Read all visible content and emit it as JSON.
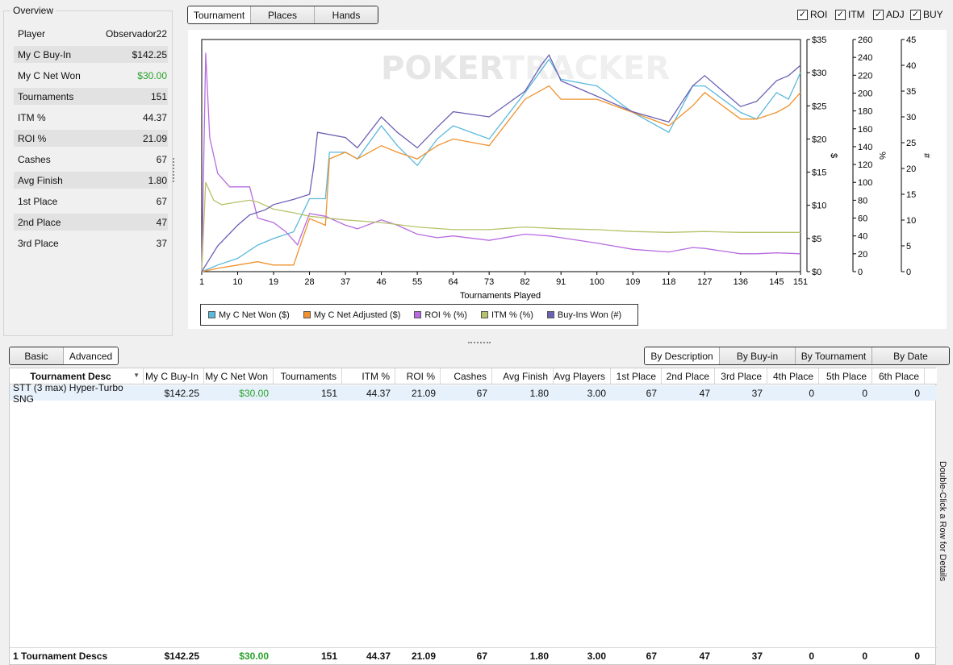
{
  "overview": {
    "title": "Overview",
    "rows": [
      {
        "label": "Player",
        "value": "Observador22"
      },
      {
        "label": "My C Buy-In",
        "value": "$142.25"
      },
      {
        "label": "My C Net Won",
        "value": "$30.00"
      },
      {
        "label": "Tournaments",
        "value": "151"
      },
      {
        "label": "ITM %",
        "value": "44.37"
      },
      {
        "label": "ROI %",
        "value": "21.09"
      },
      {
        "label": "Cashes",
        "value": "67"
      },
      {
        "label": "Avg Finish",
        "value": "1.80"
      },
      {
        "label": "1st Place",
        "value": "67"
      },
      {
        "label": "2nd Place",
        "value": "47"
      },
      {
        "label": "3rd Place",
        "value": "37"
      }
    ]
  },
  "top_tabs": [
    "Tournament",
    "Places",
    "Hands"
  ],
  "toggles": [
    {
      "label": "ROI",
      "checked": true
    },
    {
      "label": "ITM",
      "checked": true
    },
    {
      "label": "ADJ",
      "checked": true
    },
    {
      "label": "BUY",
      "checked": true
    }
  ],
  "chart_data": {
    "type": "line",
    "watermark": {
      "a": "POKER",
      "b": "TRACKER"
    },
    "xlabel": "Tournaments Played",
    "xlim": [
      1,
      151
    ],
    "x_ticks": [
      "1",
      "10",
      "19",
      "28",
      "37",
      "46",
      "55",
      "64",
      "73",
      "82",
      "91",
      "100",
      "109",
      "118",
      "127",
      "136",
      "145",
      "151"
    ],
    "axes": [
      {
        "label": "$",
        "ylim": [
          0,
          35
        ],
        "ticks": [
          "$0",
          "$5",
          "$10",
          "$15",
          "$20",
          "$25",
          "$30",
          "$35"
        ]
      },
      {
        "label": "%",
        "ylim": [
          0,
          260
        ],
        "ticks": [
          "0",
          "20",
          "40",
          "60",
          "80",
          "100",
          "120",
          "140",
          "160",
          "180",
          "200",
          "220",
          "240",
          "260"
        ]
      },
      {
        "label": "#",
        "ylim": [
          0,
          45
        ],
        "ticks": [
          "0",
          "5",
          "10",
          "15",
          "20",
          "25",
          "30",
          "35",
          "40",
          "45"
        ]
      }
    ],
    "series": [
      {
        "name": "My C Net Won ($)",
        "color": "#5bb9dc",
        "axis": 0,
        "points": [
          [
            1,
            0
          ],
          [
            5,
            1
          ],
          [
            10,
            2
          ],
          [
            15,
            4
          ],
          [
            19,
            5
          ],
          [
            24,
            6
          ],
          [
            28,
            11
          ],
          [
            32,
            11
          ],
          [
            33,
            18
          ],
          [
            37,
            18
          ],
          [
            40,
            17
          ],
          [
            46,
            22
          ],
          [
            50,
            19
          ],
          [
            55,
            16
          ],
          [
            60,
            20
          ],
          [
            64,
            22
          ],
          [
            73,
            20
          ],
          [
            82,
            27
          ],
          [
            88,
            32
          ],
          [
            91,
            29
          ],
          [
            100,
            28
          ],
          [
            109,
            24
          ],
          [
            118,
            21
          ],
          [
            124,
            28
          ],
          [
            127,
            28
          ],
          [
            136,
            24
          ],
          [
            140,
            23
          ],
          [
            145,
            27
          ],
          [
            148,
            26
          ],
          [
            151,
            30
          ]
        ]
      },
      {
        "name": "My C Net Adjusted ($)",
        "color": "#f0922e",
        "axis": 0,
        "points": [
          [
            1,
            0
          ],
          [
            5,
            0.5
          ],
          [
            10,
            1
          ],
          [
            15,
            1.5
          ],
          [
            19,
            1
          ],
          [
            24,
            1
          ],
          [
            28,
            8
          ],
          [
            32,
            7
          ],
          [
            33,
            17
          ],
          [
            37,
            18
          ],
          [
            40,
            17
          ],
          [
            46,
            19
          ],
          [
            50,
            18
          ],
          [
            55,
            17
          ],
          [
            60,
            19
          ],
          [
            64,
            20
          ],
          [
            73,
            19
          ],
          [
            82,
            26
          ],
          [
            88,
            28
          ],
          [
            91,
            26
          ],
          [
            100,
            26
          ],
          [
            109,
            24
          ],
          [
            118,
            22
          ],
          [
            124,
            25
          ],
          [
            127,
            27
          ],
          [
            136,
            23
          ],
          [
            140,
            23
          ],
          [
            145,
            24
          ],
          [
            148,
            25
          ],
          [
            151,
            27
          ]
        ]
      },
      {
        "name": "ROI % (%)",
        "color": "#b86be0",
        "axis": 1,
        "points": [
          [
            1,
            0
          ],
          [
            2,
            245
          ],
          [
            3,
            150
          ],
          [
            5,
            110
          ],
          [
            8,
            95
          ],
          [
            10,
            95
          ],
          [
            13,
            95
          ],
          [
            15,
            60
          ],
          [
            19,
            55
          ],
          [
            22,
            45
          ],
          [
            25,
            30
          ],
          [
            28,
            65
          ],
          [
            32,
            62
          ],
          [
            37,
            52
          ],
          [
            40,
            48
          ],
          [
            46,
            58
          ],
          [
            50,
            52
          ],
          [
            55,
            42
          ],
          [
            60,
            38
          ],
          [
            64,
            40
          ],
          [
            73,
            35
          ],
          [
            82,
            42
          ],
          [
            88,
            40
          ],
          [
            91,
            38
          ],
          [
            100,
            32
          ],
          [
            109,
            25
          ],
          [
            118,
            22
          ],
          [
            124,
            27
          ],
          [
            127,
            26
          ],
          [
            136,
            20
          ],
          [
            140,
            20
          ],
          [
            145,
            21
          ],
          [
            151,
            20
          ]
        ]
      },
      {
        "name": "ITM % (%)",
        "color": "#b7c26a",
        "axis": 1,
        "points": [
          [
            1,
            0
          ],
          [
            2,
            100
          ],
          [
            4,
            80
          ],
          [
            6,
            75
          ],
          [
            10,
            78
          ],
          [
            13,
            80
          ],
          [
            15,
            78
          ],
          [
            19,
            70
          ],
          [
            24,
            66
          ],
          [
            28,
            62
          ],
          [
            37,
            58
          ],
          [
            46,
            55
          ],
          [
            55,
            50
          ],
          [
            64,
            47
          ],
          [
            73,
            47
          ],
          [
            82,
            50
          ],
          [
            91,
            48
          ],
          [
            100,
            47
          ],
          [
            109,
            45
          ],
          [
            118,
            44
          ],
          [
            127,
            45
          ],
          [
            136,
            44
          ],
          [
            145,
            44
          ],
          [
            151,
            44
          ]
        ]
      },
      {
        "name": "Buy-Ins Won (#)",
        "color": "#6b62b5",
        "axis": 2,
        "points": [
          [
            1,
            0
          ],
          [
            5,
            5
          ],
          [
            10,
            9
          ],
          [
            13,
            11
          ],
          [
            17,
            12
          ],
          [
            19,
            13
          ],
          [
            24,
            14
          ],
          [
            28,
            15
          ],
          [
            29,
            20
          ],
          [
            30,
            27
          ],
          [
            37,
            26
          ],
          [
            40,
            24
          ],
          [
            46,
            30
          ],
          [
            50,
            27
          ],
          [
            55,
            24
          ],
          [
            60,
            28
          ],
          [
            64,
            31
          ],
          [
            73,
            30
          ],
          [
            82,
            35
          ],
          [
            86,
            40
          ],
          [
            88,
            42
          ],
          [
            91,
            37
          ],
          [
            100,
            34
          ],
          [
            109,
            31
          ],
          [
            118,
            29
          ],
          [
            124,
            36
          ],
          [
            127,
            38
          ],
          [
            136,
            32
          ],
          [
            140,
            33
          ],
          [
            145,
            37
          ],
          [
            148,
            38
          ],
          [
            151,
            40
          ]
        ]
      }
    ]
  },
  "bottom_left_tabs": [
    "Basic",
    "Advanced"
  ],
  "bottom_right_tabs": [
    "By Description",
    "By Buy-in",
    "By Tournament",
    "By Date"
  ],
  "grid": {
    "columns": [
      "Tournament Desc",
      "My C Buy-In",
      "My C Net Won",
      "Tournaments",
      "ITM %",
      "ROI %",
      "Cashes",
      "Avg Finish",
      "Avg Players",
      "1st Place",
      "2nd Place",
      "3rd Place",
      "4th Place",
      "5th Place",
      "6th Place"
    ],
    "row": [
      "STT (3 max) Hyper-Turbo SNG",
      "$142.25",
      "$30.00",
      "151",
      "44.37",
      "21.09",
      "67",
      "1.80",
      "3.00",
      "67",
      "47",
      "37",
      "0",
      "0",
      "0"
    ],
    "footer": [
      "1 Tournament Descs",
      "$142.25",
      "$30.00",
      "151",
      "44.37",
      "21.09",
      "67",
      "1.80",
      "3.00",
      "67",
      "47",
      "37",
      "0",
      "0",
      "0"
    ],
    "side_note": "Double-Click a Row for Details"
  }
}
